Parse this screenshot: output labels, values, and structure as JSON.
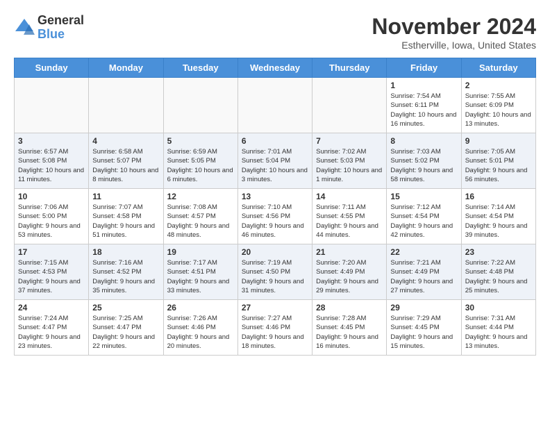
{
  "header": {
    "logo_general": "General",
    "logo_blue": "Blue",
    "month_title": "November 2024",
    "location": "Estherville, Iowa, United States"
  },
  "weekdays": [
    "Sunday",
    "Monday",
    "Tuesday",
    "Wednesday",
    "Thursday",
    "Friday",
    "Saturday"
  ],
  "weeks": [
    [
      {
        "day": "",
        "info": ""
      },
      {
        "day": "",
        "info": ""
      },
      {
        "day": "",
        "info": ""
      },
      {
        "day": "",
        "info": ""
      },
      {
        "day": "",
        "info": ""
      },
      {
        "day": "1",
        "info": "Sunrise: 7:54 AM\nSunset: 6:11 PM\nDaylight: 10 hours and 16 minutes."
      },
      {
        "day": "2",
        "info": "Sunrise: 7:55 AM\nSunset: 6:09 PM\nDaylight: 10 hours and 13 minutes."
      }
    ],
    [
      {
        "day": "3",
        "info": "Sunrise: 6:57 AM\nSunset: 5:08 PM\nDaylight: 10 hours and 11 minutes."
      },
      {
        "day": "4",
        "info": "Sunrise: 6:58 AM\nSunset: 5:07 PM\nDaylight: 10 hours and 8 minutes."
      },
      {
        "day": "5",
        "info": "Sunrise: 6:59 AM\nSunset: 5:05 PM\nDaylight: 10 hours and 6 minutes."
      },
      {
        "day": "6",
        "info": "Sunrise: 7:01 AM\nSunset: 5:04 PM\nDaylight: 10 hours and 3 minutes."
      },
      {
        "day": "7",
        "info": "Sunrise: 7:02 AM\nSunset: 5:03 PM\nDaylight: 10 hours and 1 minute."
      },
      {
        "day": "8",
        "info": "Sunrise: 7:03 AM\nSunset: 5:02 PM\nDaylight: 9 hours and 58 minutes."
      },
      {
        "day": "9",
        "info": "Sunrise: 7:05 AM\nSunset: 5:01 PM\nDaylight: 9 hours and 56 minutes."
      }
    ],
    [
      {
        "day": "10",
        "info": "Sunrise: 7:06 AM\nSunset: 5:00 PM\nDaylight: 9 hours and 53 minutes."
      },
      {
        "day": "11",
        "info": "Sunrise: 7:07 AM\nSunset: 4:58 PM\nDaylight: 9 hours and 51 minutes."
      },
      {
        "day": "12",
        "info": "Sunrise: 7:08 AM\nSunset: 4:57 PM\nDaylight: 9 hours and 48 minutes."
      },
      {
        "day": "13",
        "info": "Sunrise: 7:10 AM\nSunset: 4:56 PM\nDaylight: 9 hours and 46 minutes."
      },
      {
        "day": "14",
        "info": "Sunrise: 7:11 AM\nSunset: 4:55 PM\nDaylight: 9 hours and 44 minutes."
      },
      {
        "day": "15",
        "info": "Sunrise: 7:12 AM\nSunset: 4:54 PM\nDaylight: 9 hours and 42 minutes."
      },
      {
        "day": "16",
        "info": "Sunrise: 7:14 AM\nSunset: 4:54 PM\nDaylight: 9 hours and 39 minutes."
      }
    ],
    [
      {
        "day": "17",
        "info": "Sunrise: 7:15 AM\nSunset: 4:53 PM\nDaylight: 9 hours and 37 minutes."
      },
      {
        "day": "18",
        "info": "Sunrise: 7:16 AM\nSunset: 4:52 PM\nDaylight: 9 hours and 35 minutes."
      },
      {
        "day": "19",
        "info": "Sunrise: 7:17 AM\nSunset: 4:51 PM\nDaylight: 9 hours and 33 minutes."
      },
      {
        "day": "20",
        "info": "Sunrise: 7:19 AM\nSunset: 4:50 PM\nDaylight: 9 hours and 31 minutes."
      },
      {
        "day": "21",
        "info": "Sunrise: 7:20 AM\nSunset: 4:49 PM\nDaylight: 9 hours and 29 minutes."
      },
      {
        "day": "22",
        "info": "Sunrise: 7:21 AM\nSunset: 4:49 PM\nDaylight: 9 hours and 27 minutes."
      },
      {
        "day": "23",
        "info": "Sunrise: 7:22 AM\nSunset: 4:48 PM\nDaylight: 9 hours and 25 minutes."
      }
    ],
    [
      {
        "day": "24",
        "info": "Sunrise: 7:24 AM\nSunset: 4:47 PM\nDaylight: 9 hours and 23 minutes."
      },
      {
        "day": "25",
        "info": "Sunrise: 7:25 AM\nSunset: 4:47 PM\nDaylight: 9 hours and 22 minutes."
      },
      {
        "day": "26",
        "info": "Sunrise: 7:26 AM\nSunset: 4:46 PM\nDaylight: 9 hours and 20 minutes."
      },
      {
        "day": "27",
        "info": "Sunrise: 7:27 AM\nSunset: 4:46 PM\nDaylight: 9 hours and 18 minutes."
      },
      {
        "day": "28",
        "info": "Sunrise: 7:28 AM\nSunset: 4:45 PM\nDaylight: 9 hours and 16 minutes."
      },
      {
        "day": "29",
        "info": "Sunrise: 7:29 AM\nSunset: 4:45 PM\nDaylight: 9 hours and 15 minutes."
      },
      {
        "day": "30",
        "info": "Sunrise: 7:31 AM\nSunset: 4:44 PM\nDaylight: 9 hours and 13 minutes."
      }
    ]
  ]
}
